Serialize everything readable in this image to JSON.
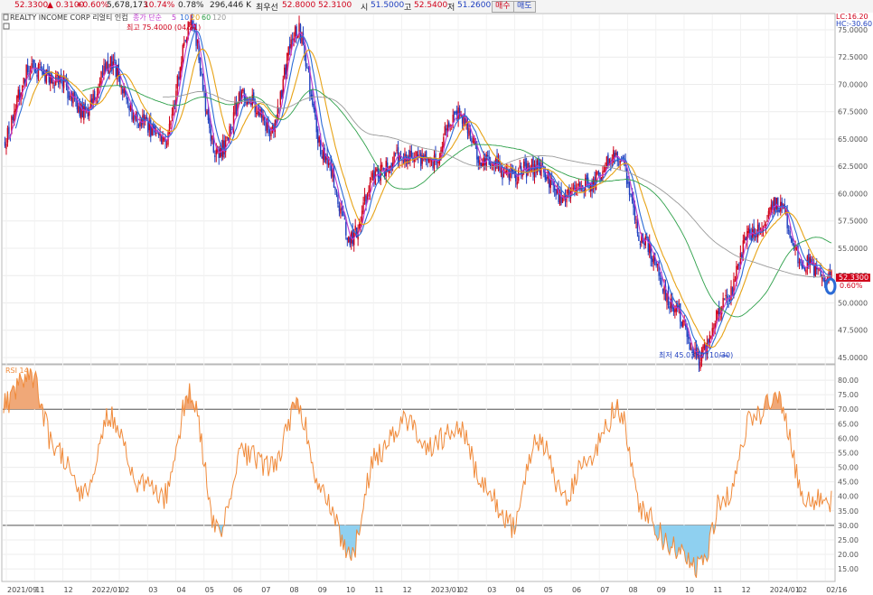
{
  "quote_bar": {
    "price": "52.3300",
    "change": "▲  0.3100",
    "change_pct": "+0.60%",
    "volume": "5,678,173",
    "turnover_pct": "10.74%",
    "ratio": "0.78%",
    "amount": "296,446 K",
    "prio_label": "최우선",
    "prio_ask": "52.8000",
    "prio_bid": "52.3100",
    "open_label": "시",
    "open": "51.5000",
    "high_label": "고",
    "high": "52.5400",
    "low_label": "저",
    "low": "51.2600",
    "buy_label": "매수",
    "sell_label": "매도"
  },
  "legend": {
    "name": "REALTY INCOME CORP  리얼티 인컴",
    "ma_label": "종가 단순",
    "ma_periods": [
      "5",
      "10",
      "20",
      "60",
      "120"
    ],
    "ma_colors": [
      "#c03ad0",
      "#2b6bd6",
      "#e7a316",
      "#2ea04a",
      "#9a9a9a"
    ],
    "lc": "LC:16.20",
    "hc": "HC:-30.60"
  },
  "annotations": {
    "high_label": "최고 75.4000 (04/21)",
    "low_label": "최저 45.0350 (10/30)",
    "last_price_tag": "52.3300",
    "last_change_tag": "0.60%"
  },
  "rsi_legend": "RSI 14",
  "colors": {
    "up": "#d0021b",
    "down": "#1f3fbf",
    "rsi": "#f08a3a",
    "overbought_fill": "#f0a878",
    "oversold_fill": "#8fd0f0"
  },
  "chart_data": [
    {
      "type": "line",
      "title": "",
      "x_axis": [
        "2021/09",
        "11",
        "12",
        "2022/01",
        "02",
        "03",
        "04",
        "05",
        "06",
        "07",
        "08",
        "09",
        "10",
        "11",
        "12",
        "2023/01",
        "02",
        "03",
        "04",
        "05",
        "06",
        "07",
        "08",
        "09",
        "10",
        "11",
        "12",
        "2024/01",
        "02",
        "02/16"
      ],
      "ylim": [
        44.5,
        76.4
      ],
      "y_ticks": [
        "45.0000",
        "47.5000",
        "50.0000",
        "52.5000",
        "55.0000",
        "57.5000",
        "60.0000",
        "62.5000",
        "65.0000",
        "67.5000",
        "70.0000",
        "72.5000",
        "75.0000"
      ],
      "series": [
        {
          "name": "종가",
          "points": [
            [
              "2021/09",
              65.0
            ],
            [
              "2021/10",
              71.5
            ],
            [
              "2021/11",
              70.5
            ],
            [
              "2021/12",
              67.5
            ],
            [
              "2022/01",
              72.0
            ],
            [
              "2022/02",
              66.8
            ],
            [
              "2022/03",
              65.0
            ],
            [
              "2022/04",
              75.4
            ],
            [
              "2022/05",
              63.5
            ],
            [
              "2022/06",
              69.0
            ],
            [
              "2022/07",
              66.0
            ],
            [
              "2022/08",
              75.0
            ],
            [
              "2022/09",
              63.5
            ],
            [
              "2022/10",
              56.0
            ],
            [
              "2022/11",
              62.0
            ],
            [
              "2022/12",
              63.5
            ],
            [
              "2023/01",
              63.0
            ],
            [
              "2023/02",
              67.5
            ],
            [
              "2023/03",
              63.0
            ],
            [
              "2023/04",
              61.8
            ],
            [
              "2023/05",
              62.5
            ],
            [
              "2023/06",
              59.5
            ],
            [
              "2023/07",
              61.0
            ],
            [
              "2023/08",
              63.5
            ],
            [
              "2023/09",
              55.5
            ],
            [
              "2023/10",
              50.0
            ],
            [
              "2023/10/30",
              45.035
            ],
            [
              "2023/11",
              50.0
            ],
            [
              "2023/12",
              56.5
            ],
            [
              "2024/01",
              59.0
            ],
            [
              "2024/02",
              53.5
            ],
            [
              "2024/02/16",
              52.33
            ]
          ]
        }
      ]
    },
    {
      "type": "line",
      "title": "RSI 14",
      "ylim": [
        11,
        85
      ],
      "y_ticks": [
        "15.00",
        "20.00",
        "25.00",
        "30.00",
        "35.00",
        "40.00",
        "45.00",
        "50.00",
        "55.00",
        "60.00",
        "65.00",
        "70.00",
        "75.00",
        "80.00"
      ],
      "reference_lines": [
        30,
        70
      ],
      "series": [
        {
          "name": "RSI 14",
          "points": [
            [
              "2021/09",
              72
            ],
            [
              "2021/10",
              82
            ],
            [
              "2021/11",
              55
            ],
            [
              "2021/12",
              40
            ],
            [
              "2022/01",
              68
            ],
            [
              "2022/02",
              45
            ],
            [
              "2022/03",
              40
            ],
            [
              "2022/04",
              76
            ],
            [
              "2022/05",
              28
            ],
            [
              "2022/06",
              55
            ],
            [
              "2022/07",
              50
            ],
            [
              "2022/08",
              70
            ],
            [
              "2022/09",
              40
            ],
            [
              "2022/10",
              20
            ],
            [
              "2022/11",
              55
            ],
            [
              "2022/12",
              66
            ],
            [
              "2023/01",
              58
            ],
            [
              "2023/02",
              65
            ],
            [
              "2023/03",
              43
            ],
            [
              "2023/04",
              30
            ],
            [
              "2023/05",
              60
            ],
            [
              "2023/06",
              40
            ],
            [
              "2023/07",
              55
            ],
            [
              "2023/08",
              70
            ],
            [
              "2023/09",
              35
            ],
            [
              "2023/10",
              22
            ],
            [
              "2023/10/30",
              15
            ],
            [
              "2023/11",
              40
            ],
            [
              "2023/12",
              66
            ],
            [
              "2024/01",
              74
            ],
            [
              "2024/02",
              40
            ],
            [
              "2024/02/16",
              38
            ]
          ]
        }
      ]
    }
  ]
}
